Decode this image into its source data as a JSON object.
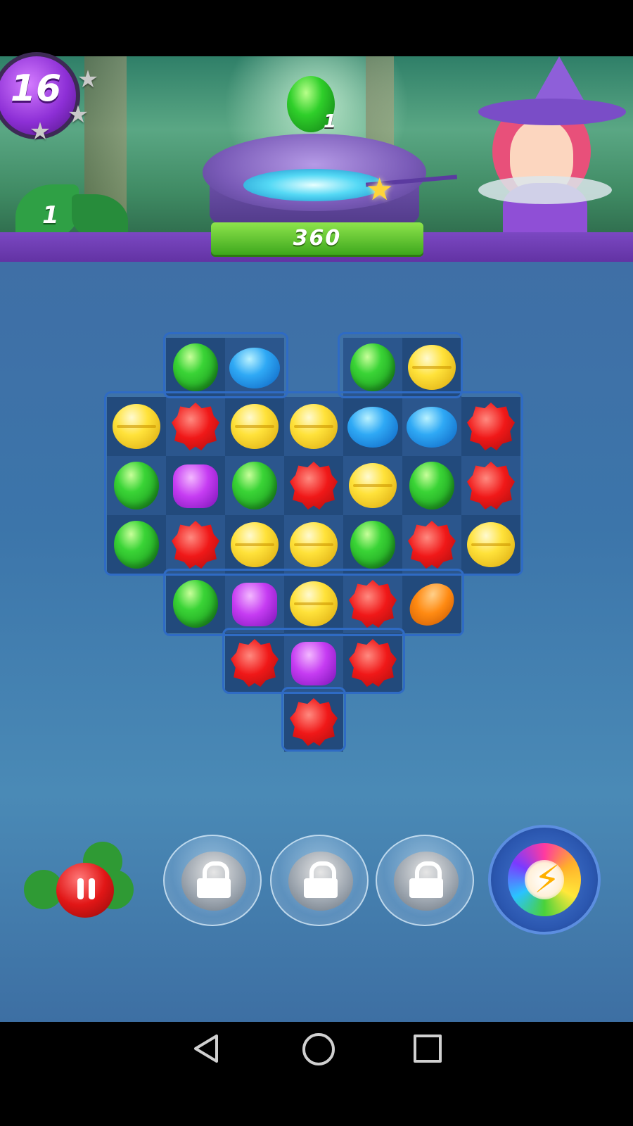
{
  "hud": {
    "level": "16",
    "leaf_goal_count": "1",
    "candy_goal_count": "1",
    "score": "360"
  },
  "board": {
    "rows": [
      [
        null,
        "green",
        "blue",
        null,
        "green",
        "yellow",
        null
      ],
      [
        "yellow",
        "red",
        "yellow",
        "yellow",
        "blue",
        "blue",
        "red"
      ],
      [
        "green",
        "purple",
        "green",
        "red",
        "yellow",
        "green",
        "red"
      ],
      [
        "green",
        "red",
        "yellow",
        "yellow",
        "green",
        "red",
        "yellow"
      ],
      [
        null,
        "green",
        "purple",
        "yellow",
        "red",
        "orange",
        null
      ],
      [
        null,
        null,
        "red",
        "purple",
        "red",
        null,
        null
      ],
      [
        null,
        null,
        null,
        "red",
        null,
        null,
        null
      ]
    ]
  },
  "boosters": {
    "slots": [
      {
        "name": "locked-slot-1",
        "icon": "lock-icon"
      },
      {
        "name": "locked-slot-2",
        "icon": "lock-icon"
      },
      {
        "name": "locked-slot-3",
        "icon": "lock-icon"
      }
    ],
    "rainbow_icon": "rainbow-bolt-icon",
    "pause_icon": "pause-icon"
  },
  "nav": {
    "back_icon": "back-triangle-icon",
    "home_icon": "home-circle-icon",
    "recent_icon": "recents-square-icon"
  }
}
